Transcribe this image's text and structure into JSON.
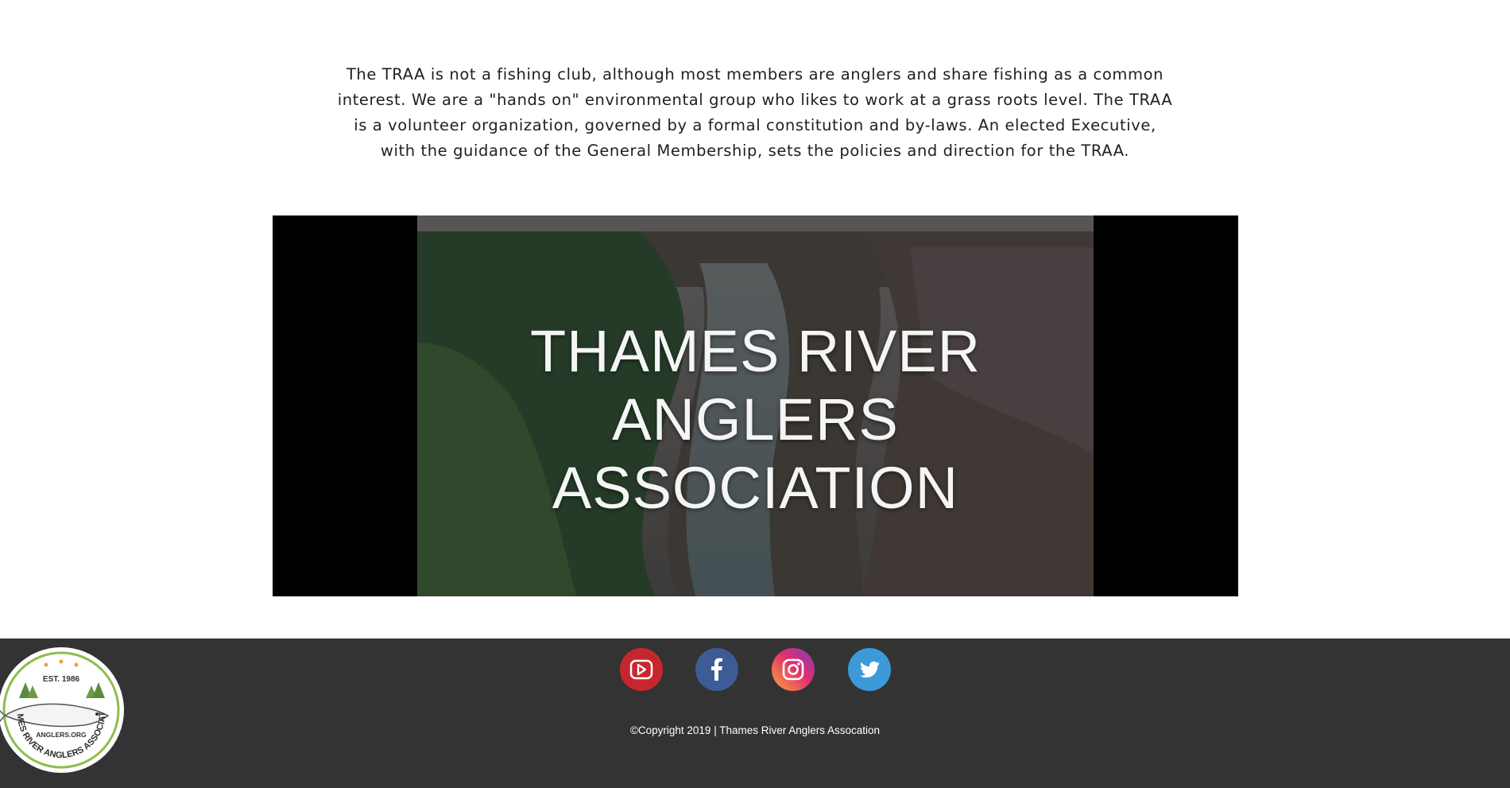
{
  "intro": {
    "text": "The TRAA is not a fishing club, although most members are anglers and share fishing as a common interest. We are a \"hands on\" environmental group who likes to work at a grass roots level. The TRAA is a volunteer organization, governed by a formal constitution and by-laws. An elected Executive, with the guidance of the General Membership, sets the policies and direction for the TRAA."
  },
  "video": {
    "title_line1": "THAMES RIVER",
    "title_line2": "ANGLERS ASSOCIATION"
  },
  "footer": {
    "social": [
      {
        "name": "youtube-icon",
        "color": "#c4302b"
      },
      {
        "name": "facebook-icon",
        "color": "#3b5998"
      },
      {
        "name": "instagram-icon",
        "color": "#c13584"
      },
      {
        "name": "twitter-icon",
        "color": "#1da1f2"
      }
    ],
    "copyright": "©Copyright 2019 | Thames River Anglers Assocation"
  },
  "logo": {
    "top_text": "EST. 1986",
    "middle_text": "ANGLERS.ORG",
    "ring_text": "THAMES RIVER ANGLERS ASSOCIATION"
  }
}
